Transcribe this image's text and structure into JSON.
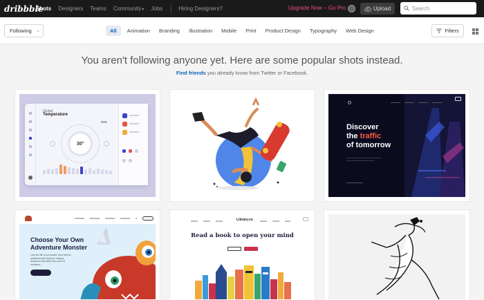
{
  "nav": {
    "logo": "dribbble",
    "links": [
      {
        "label": "Shots",
        "active": true
      },
      {
        "label": "Designers",
        "active": false
      },
      {
        "label": "Teams",
        "active": false
      },
      {
        "label": "Community",
        "active": false
      },
      {
        "label": "Jobs",
        "active": false
      },
      {
        "label": "Hiring Designers?",
        "active": false
      }
    ],
    "upgrade": "Upgrade Now – Go Pro",
    "upload": "Upload",
    "search_placeholder": "Search"
  },
  "filterbar": {
    "following": "Following",
    "categories": [
      "All",
      "Animation",
      "Branding",
      "Illustration",
      "Mobile",
      "Print",
      "Product Design",
      "Typography",
      "Web Design"
    ],
    "active_category": "All",
    "filters": "Filters"
  },
  "message": {
    "headline": "You aren't following anyone yet. Here are some popular shots instead.",
    "link": "Find friends",
    "rest": " you already know from Twitter or Facebook."
  },
  "shots": {
    "s1": {
      "sub": "Global",
      "title": "Temperature",
      "dial": "30°",
      "pct": "53%"
    },
    "s3": {
      "line1": "Discover",
      "line2a": "the ",
      "line2b": "traffic",
      "line3": "of tomorrow"
    },
    "s4": {
      "line1": "Choose Your Own",
      "line2": "Adventure Monster",
      "para": "Live the life of a monster, from birth to adulthood and beyond, making decisions that affect the world of monsters."
    },
    "s5": {
      "headline": "Read a book to open your mind",
      "brand": "Library.co"
    }
  },
  "colors": {
    "accent_pink": "#ea4c89",
    "link_blue": "#0d62b8",
    "nav_bg": "#1a1a1a"
  }
}
